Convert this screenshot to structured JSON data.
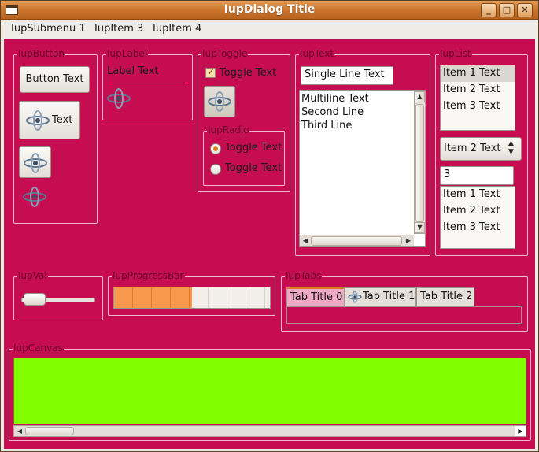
{
  "window": {
    "title": "IupDialog Title",
    "minimize_glyph": "_",
    "maximize_glyph": "□",
    "close_glyph": "✕"
  },
  "menu": [
    "IupSubmenu 1",
    "IupItem 3",
    "IupItem 4"
  ],
  "colors": {
    "background": "#c60d52",
    "canvas": "#7fff00",
    "accent": "#e07b21",
    "frame_title": "#6a052b"
  },
  "frames": {
    "button": "IupButton",
    "label": "IupLabel",
    "toggle": "IupToggle",
    "radio": "IupRadio",
    "text": "IupText",
    "list": "IupList",
    "val": "IupVal",
    "progressbar": "IupProgressBar",
    "tabs": "IupTabs",
    "canvas": "IupCanvas"
  },
  "buttons": {
    "text_button": "Button Text",
    "image_text_button": "Text"
  },
  "label": {
    "text": "Label Text"
  },
  "toggle": {
    "text": "Toggle Text",
    "checked": true
  },
  "radio": {
    "options": [
      "Toggle Text",
      "Toggle Text"
    ],
    "selected_index": 0
  },
  "text": {
    "single_line": "Single Line Text",
    "multiline": [
      "Multiline Text",
      "Second Line",
      "Third Line"
    ]
  },
  "list": {
    "list1_items": [
      "Item 1 Text",
      "Item 2 Text",
      "Item 3 Text"
    ],
    "list1_selected": 0,
    "dropdown_value": "Item 2 Text",
    "spin_value": "3",
    "list2_items": [
      "Item 1 Text",
      "Item 2 Text",
      "Item 3 Text"
    ]
  },
  "val": {
    "value": 0.05
  },
  "progress": {
    "value": 0.5
  },
  "tabs": {
    "items": [
      "Tab Title 0",
      "Tab Title 1",
      "Tab Title 2"
    ],
    "active_index": 0,
    "icon_on_tab": 1
  },
  "icons": {
    "app_icon": "orbit-icon",
    "sysmenu": "window-menu-icon"
  }
}
